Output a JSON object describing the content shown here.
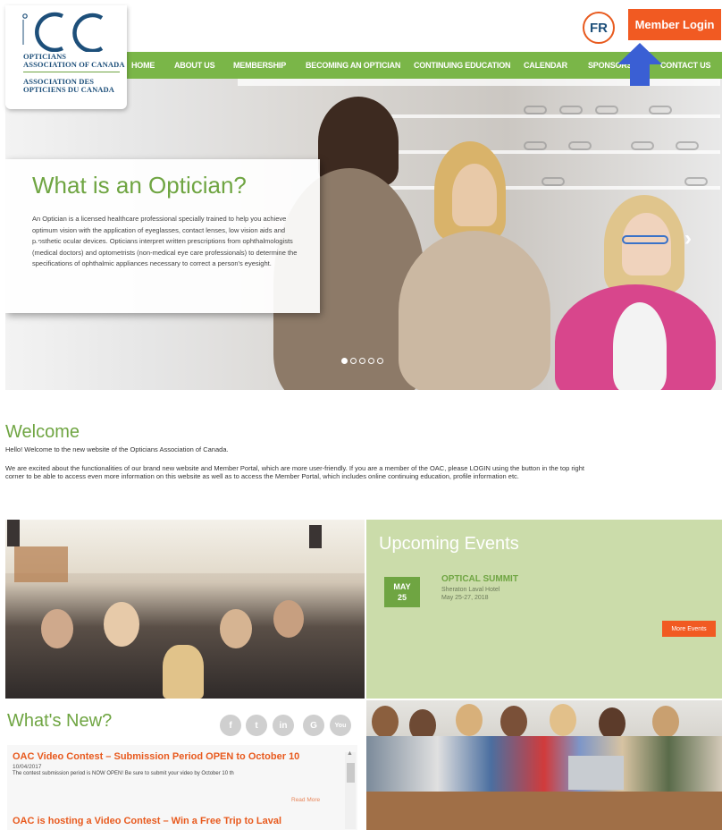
{
  "header": {
    "logo": {
      "mark": "OC",
      "line1": "Opticians",
      "line2": "Association of Canada",
      "line3": "Association des",
      "line4": "Opticiens du Canada"
    },
    "lang_button": "FR",
    "login_button": "Member Login"
  },
  "nav": {
    "items": [
      "HOME",
      "ABOUT US",
      "MEMBERSHIP",
      "BECOMING AN OPTICIAN",
      "CONTINUING EDUCATION",
      "CALENDAR",
      "SPONSORS",
      "CONTACT US"
    ]
  },
  "hero": {
    "title": "What is an Optician?",
    "text": "An Optician is a licensed healthcare professional specially trained to help you achieve optimum vision with the application of eyeglasses, contact lenses, low vision aids and prosthetic ocular devices.  Opticians interpret written prescriptions from ophthalmologists (medical doctors) and optometrists (non-medical eye care professionals) to determine the specifications of ophthalmic appliances necessary to correct a person's eyesight.",
    "prev_icon": "chevron-left-icon",
    "next_icon": "chevron-right-icon",
    "slides_total": 5,
    "slide_active": 1
  },
  "welcome": {
    "title": "Welcome",
    "p1": "Hello! Welcome to the new website of the Opticians Association of Canada.",
    "p2": "We are excited about the functionalities of our brand new website and Member Portal, which are more user-friendly. If you are a member of the OAC, please LOGIN using the button in the top right corner to be able to access even more information on this website as well as to access the Member Portal, which includes online continuing education, profile information etc."
  },
  "events": {
    "title": "Upcoming Events",
    "items": [
      {
        "month": "MAY",
        "day": "25",
        "name": "OPTICAL SUMMIT",
        "venue": "Sheraton Laval Hotel",
        "dates": "May 25-27, 2018"
      }
    ],
    "more_label": "More Events"
  },
  "whatsnew": {
    "title": "What's New?",
    "social_icons": [
      "facebook-icon",
      "twitter-icon",
      "linkedin-icon",
      "google-icon",
      "youtube-icon"
    ],
    "social_labels": [
      "f",
      "t",
      "in",
      "G",
      "You"
    ],
    "news": [
      {
        "title": "OAC Video Contest – Submission Period OPEN to October 10",
        "date": "10/04/2017",
        "body": "The contest submission period is NOW OPEN! Be sure to submit your video by October 10 th",
        "read_more": "Read More"
      },
      {
        "title": "OAC is hosting a Video Contest – Win a Free Trip to Laval",
        "date": "",
        "body": "",
        "read_more": ""
      }
    ]
  },
  "colors": {
    "brand_green": "#7ab648",
    "title_green": "#6fa542",
    "accent_orange": "#f15a22",
    "brand_blue": "#1d4f7a",
    "events_bg": "#cbdcaa"
  }
}
